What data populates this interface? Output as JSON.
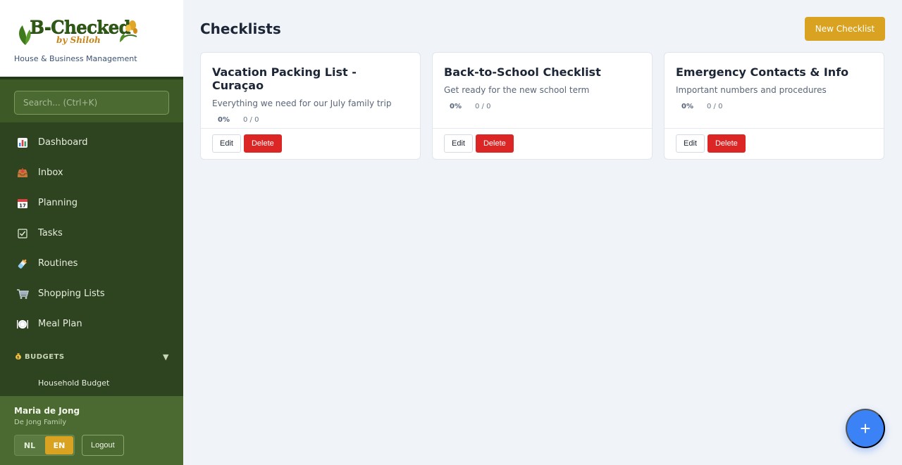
{
  "brand": {
    "wordmark": "B-Checked",
    "subtitle": "by Shiloh",
    "tagline": "House & Business Management"
  },
  "search": {
    "placeholder": "Search... (Ctrl+K)"
  },
  "nav": {
    "items": [
      {
        "label": "Dashboard",
        "icon": "bar-chart-icon"
      },
      {
        "label": "Inbox",
        "icon": "inbox-tray-icon"
      },
      {
        "label": "Planning",
        "icon": "calendar-icon"
      },
      {
        "label": "Tasks",
        "icon": "checkbox-icon"
      },
      {
        "label": "Routines",
        "icon": "baby-bottle-icon"
      },
      {
        "label": "Shopping Lists",
        "icon": "shopping-cart-icon"
      },
      {
        "label": "Meal Plan",
        "icon": "plate-cutlery-icon"
      }
    ],
    "budgets": {
      "label": "BUDGETS",
      "icon": "money-bag-icon",
      "items": [
        "Household Budget"
      ]
    }
  },
  "user": {
    "name": "Maria de Jong",
    "family": "De Jong Family",
    "lang_nl": "NL",
    "lang_en": "EN",
    "active_lang": "EN",
    "logout": "Logout"
  },
  "main": {
    "title": "Checklists",
    "new_button": "New Checklist",
    "cards": [
      {
        "title": "Vacation Packing List - Curaçao",
        "description": "Everything we need for our July family trip",
        "percent": "0%",
        "count": "0 / 0",
        "edit": "Edit",
        "delete": "Delete"
      },
      {
        "title": "Back-to-School Checklist",
        "description": "Get ready for the new school term",
        "percent": "0%",
        "count": "0 / 0",
        "edit": "Edit",
        "delete": "Delete"
      },
      {
        "title": "Emergency Contacts & Info",
        "description": "Important numbers and procedures",
        "percent": "0%",
        "count": "0 / 0",
        "edit": "Edit",
        "delete": "Delete"
      }
    ],
    "fab": "+"
  },
  "colors": {
    "sidebar": "#2e4420",
    "accent": "#d9a321",
    "danger": "#dc2626",
    "fab": "#3b82f6"
  }
}
